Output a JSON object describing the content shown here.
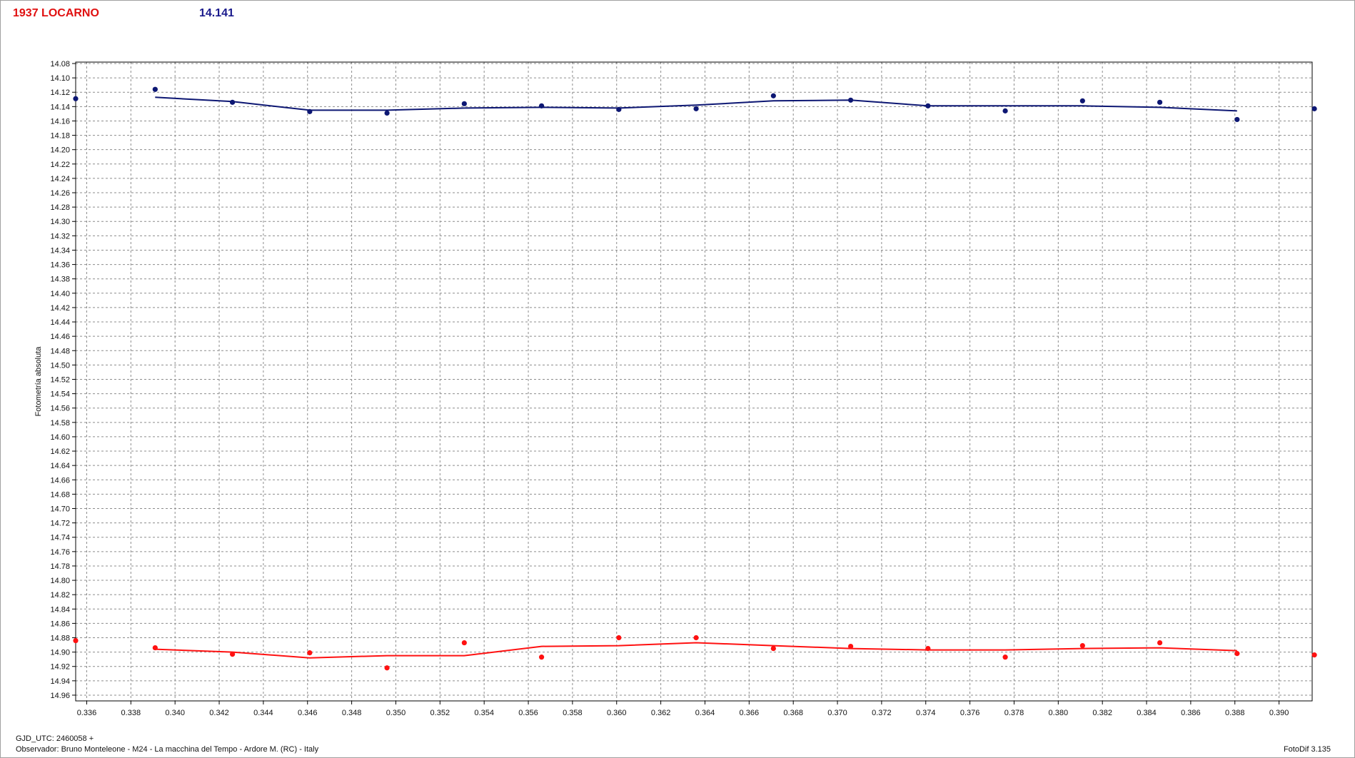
{
  "header": {
    "object_name": "1937 LOCARNO",
    "mean_value": "14.141"
  },
  "footer": {
    "gjd": "GJD_UTC: 2460058 +",
    "observer": "Observador: Bruno Monteleone - M24 - La macchina del Tempo - Ardore M. (RC) - Italy",
    "version": "FotoDif 3.135"
  },
  "colors": {
    "series_blue": "#0d1773",
    "series_red": "#ff1111",
    "grid": "#8c8c8c",
    "title_red": "#e01010",
    "title_blue": "#1a1a8c"
  },
  "chart_data": {
    "type": "scatter",
    "ylabel": "Fotometría absoluta",
    "xlabel": "",
    "xlim": [
      0.3355,
      0.3915
    ],
    "ylim": [
      14.968,
      14.078
    ],
    "y_inverted": true,
    "grid": true,
    "x_ticks": [
      "0.336",
      "0.338",
      "0.340",
      "0.342",
      "0.344",
      "0.346",
      "0.348",
      "0.350",
      "0.352",
      "0.354",
      "0.356",
      "0.358",
      "0.360",
      "0.362",
      "0.364",
      "0.366",
      "0.368",
      "0.370",
      "0.372",
      "0.374",
      "0.376",
      "0.378",
      "0.380",
      "0.382",
      "0.384",
      "0.386",
      "0.388",
      "0.390"
    ],
    "y_ticks": [
      "14.08",
      "14.10",
      "14.12",
      "14.14",
      "14.16",
      "14.18",
      "14.20",
      "14.22",
      "14.24",
      "14.26",
      "14.28",
      "14.30",
      "14.32",
      "14.34",
      "14.36",
      "14.38",
      "14.40",
      "14.42",
      "14.44",
      "14.46",
      "14.48",
      "14.50",
      "14.52",
      "14.54",
      "14.56",
      "14.58",
      "14.60",
      "14.62",
      "14.64",
      "14.66",
      "14.68",
      "14.70",
      "14.72",
      "14.74",
      "14.76",
      "14.78",
      "14.80",
      "14.82",
      "14.84",
      "14.86",
      "14.88",
      "14.90",
      "14.92",
      "14.94",
      "14.96"
    ],
    "series": [
      {
        "color": "#0d1773",
        "points": [
          [
            0.3355,
            14.129
          ],
          [
            0.3391,
            14.116
          ],
          [
            0.3426,
            14.134
          ],
          [
            0.3461,
            14.147
          ],
          [
            0.3496,
            14.149
          ],
          [
            0.3531,
            14.136
          ],
          [
            0.3566,
            14.139
          ],
          [
            0.3601,
            14.144
          ],
          [
            0.3636,
            14.143
          ],
          [
            0.3671,
            14.125
          ],
          [
            0.3706,
            14.131
          ],
          [
            0.3741,
            14.139
          ],
          [
            0.3776,
            14.146
          ],
          [
            0.3811,
            14.132
          ],
          [
            0.3846,
            14.134
          ],
          [
            0.3881,
            14.158
          ],
          [
            0.3916,
            14.143
          ]
        ],
        "trend": [
          [
            0.3391,
            14.127
          ],
          [
            0.3426,
            14.133
          ],
          [
            0.3461,
            14.145
          ],
          [
            0.3496,
            14.145
          ],
          [
            0.3531,
            14.142
          ],
          [
            0.3566,
            14.141
          ],
          [
            0.3601,
            14.142
          ],
          [
            0.3636,
            14.138
          ],
          [
            0.3671,
            14.132
          ],
          [
            0.3706,
            14.131
          ],
          [
            0.3741,
            14.139
          ],
          [
            0.3776,
            14.139
          ],
          [
            0.3811,
            14.139
          ],
          [
            0.3846,
            14.141
          ],
          [
            0.3881,
            14.146
          ]
        ]
      },
      {
        "color": "#ff1111",
        "points": [
          [
            0.3355,
            14.884
          ],
          [
            0.3391,
            14.894
          ],
          [
            0.3426,
            14.903
          ],
          [
            0.3461,
            14.901
          ],
          [
            0.3496,
            14.922
          ],
          [
            0.3531,
            14.887
          ],
          [
            0.3566,
            14.907
          ],
          [
            0.3601,
            14.88
          ],
          [
            0.3636,
            14.88
          ],
          [
            0.3671,
            14.895
          ],
          [
            0.3706,
            14.892
          ],
          [
            0.3741,
            14.895
          ],
          [
            0.3776,
            14.907
          ],
          [
            0.3811,
            14.891
          ],
          [
            0.3846,
            14.887
          ],
          [
            0.3881,
            14.902
          ],
          [
            0.3916,
            14.904
          ]
        ],
        "trend": [
          [
            0.3391,
            14.896
          ],
          [
            0.3426,
            14.9
          ],
          [
            0.3461,
            14.908
          ],
          [
            0.3496,
            14.905
          ],
          [
            0.3531,
            14.905
          ],
          [
            0.3566,
            14.892
          ],
          [
            0.3601,
            14.891
          ],
          [
            0.3636,
            14.887
          ],
          [
            0.3671,
            14.891
          ],
          [
            0.3706,
            14.895
          ],
          [
            0.3741,
            14.897
          ],
          [
            0.3776,
            14.897
          ],
          [
            0.3811,
            14.895
          ],
          [
            0.3846,
            14.894
          ],
          [
            0.3881,
            14.898
          ]
        ]
      }
    ]
  }
}
